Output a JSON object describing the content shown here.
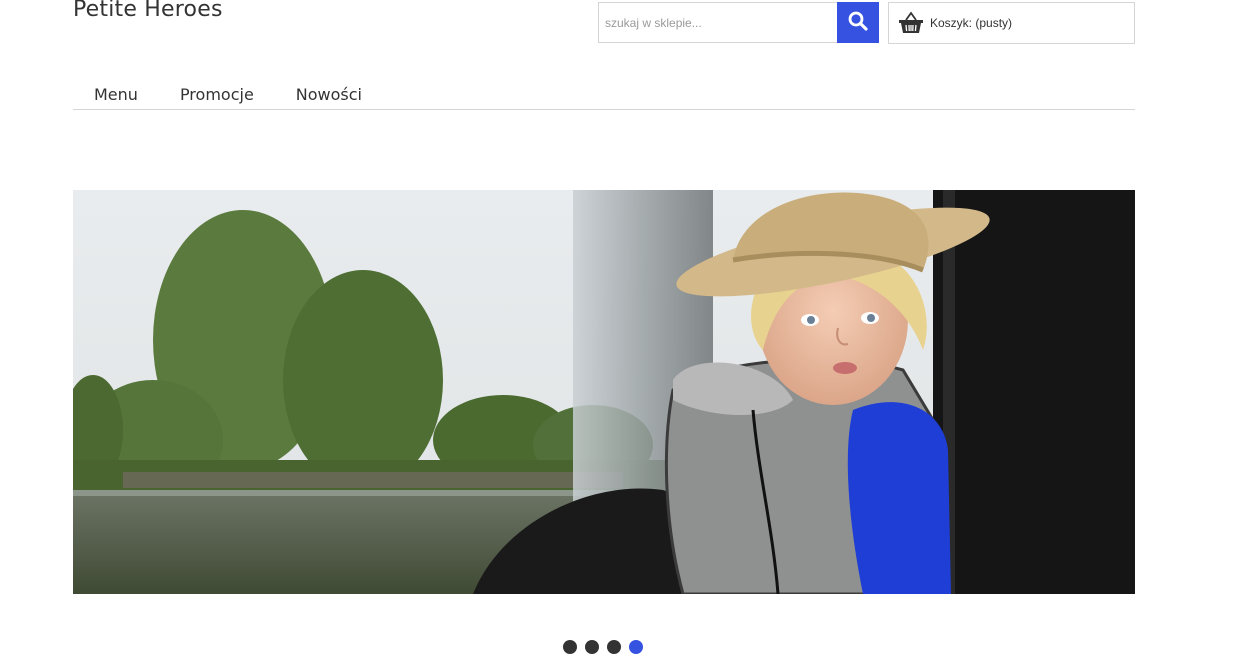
{
  "header": {
    "logo_text": "Petite Heroes",
    "search": {
      "placeholder": "szukaj w sklepie...",
      "value": "",
      "button_icon": "search-icon"
    },
    "cart": {
      "icon": "basket-icon",
      "label": "Koszyk: (pusty)"
    }
  },
  "nav": {
    "items": [
      {
        "label": "Menu"
      },
      {
        "label": "Promocje"
      },
      {
        "label": "Nowości"
      }
    ]
  },
  "slider": {
    "slide_count": 4,
    "active_index": 3
  },
  "colors": {
    "accent": "#3552e0",
    "text": "#333333",
    "border": "#d6d4d4"
  }
}
